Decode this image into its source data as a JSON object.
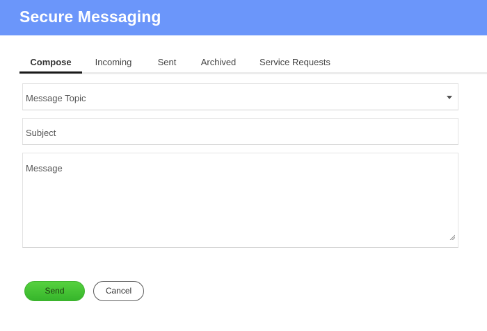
{
  "header": {
    "title": "Secure Messaging"
  },
  "tabs": [
    {
      "label": "Compose",
      "active": true
    },
    {
      "label": "Incoming",
      "active": false
    },
    {
      "label": "Sent",
      "active": false
    },
    {
      "label": "Archived",
      "active": false
    },
    {
      "label": "Service Requests",
      "active": false
    }
  ],
  "form": {
    "topic": {
      "placeholder": "Message Topic",
      "icon": "chevron-down-icon"
    },
    "subject": {
      "placeholder": "Subject"
    },
    "message": {
      "placeholder": "Message"
    }
  },
  "actions": {
    "send_label": "Send",
    "cancel_label": "Cancel"
  },
  "colors": {
    "header_bg": "#6b96fa",
    "active_tab_underline": "#1a1a1a",
    "send_button": "#45c236"
  }
}
